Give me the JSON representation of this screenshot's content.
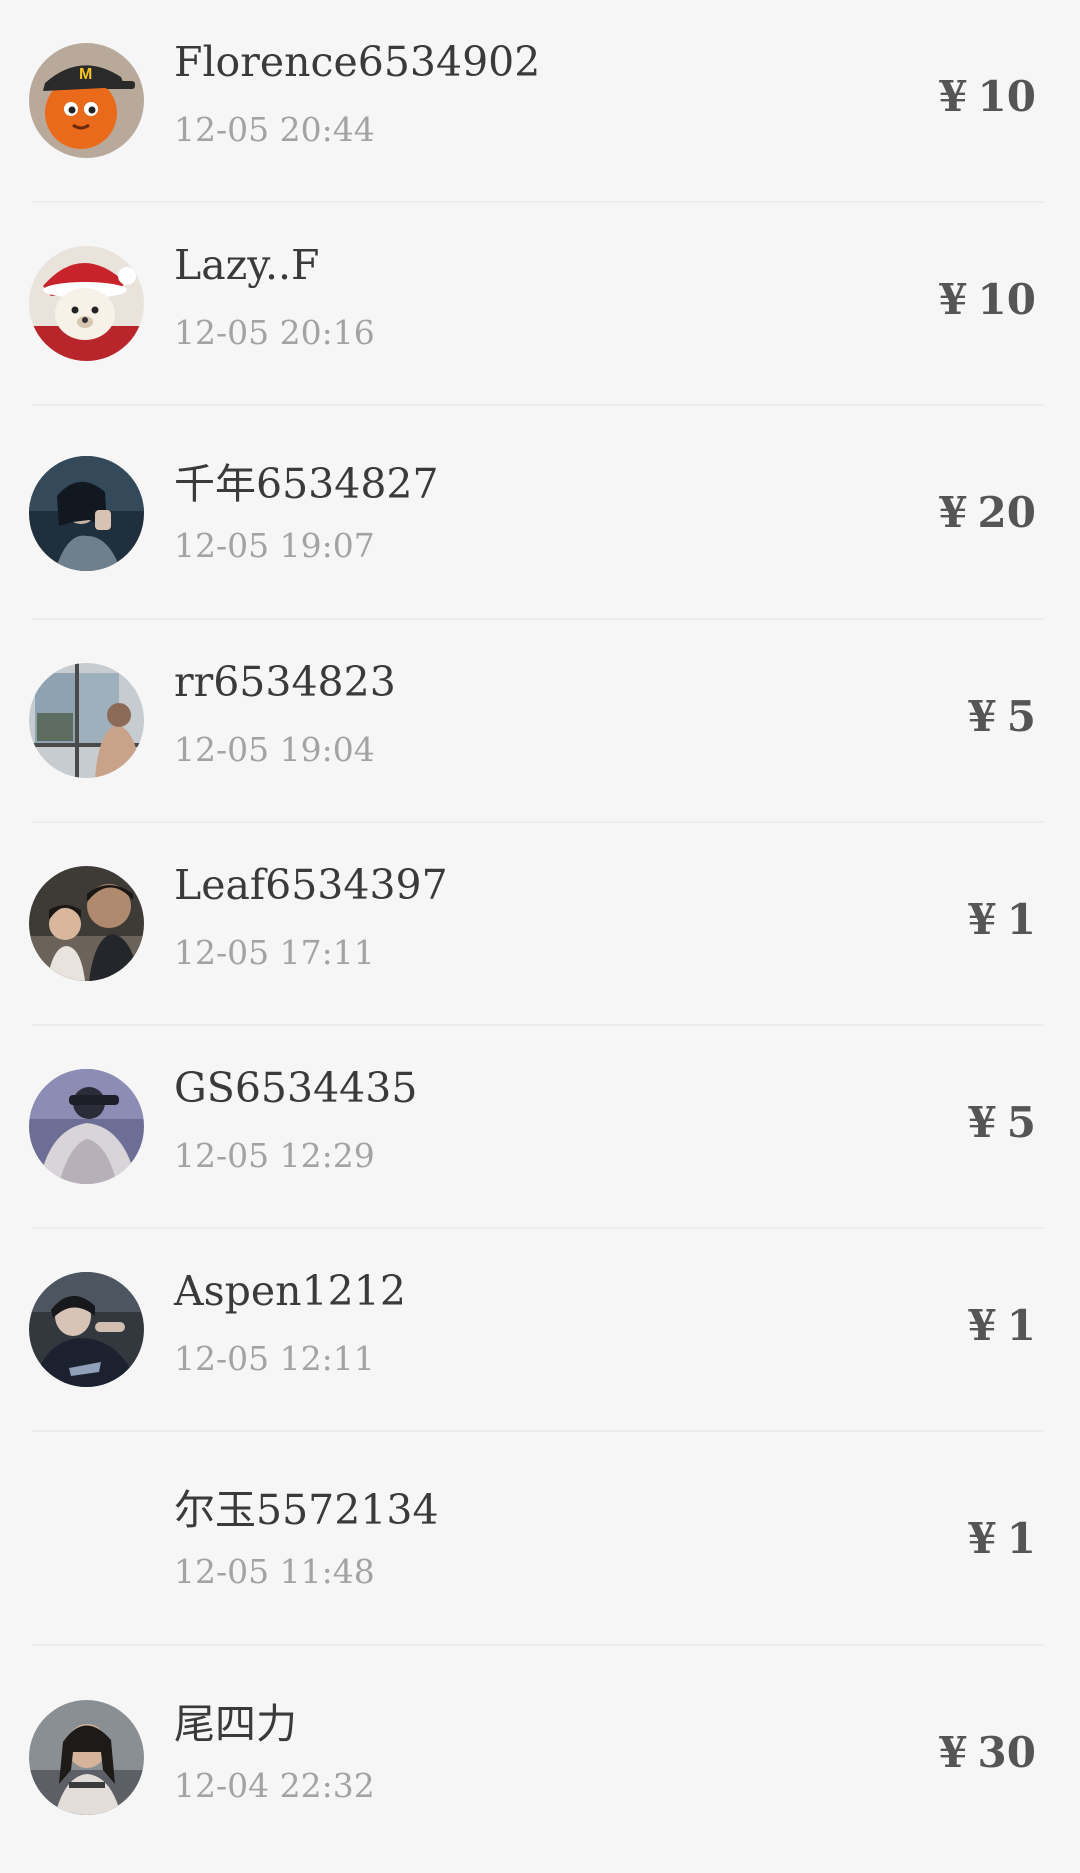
{
  "currency_symbol": "¥",
  "items": [
    {
      "name": "Florence6534902",
      "time": "12-05 20:44",
      "amount": "10",
      "avatar_icon": "mascot-avatar"
    },
    {
      "name": "Lazy..F",
      "time": "12-05 20:16",
      "amount": "10",
      "avatar_icon": "bear-avatar"
    },
    {
      "name": "千年6534827",
      "time": "12-05 19:07",
      "amount": "20",
      "avatar_icon": "photo-avatar"
    },
    {
      "name": "rr6534823",
      "time": "12-05 19:04",
      "amount": "5",
      "avatar_icon": "window-avatar"
    },
    {
      "name": "Leaf6534397",
      "time": "12-05 17:11",
      "amount": "1",
      "avatar_icon": "photo-avatar"
    },
    {
      "name": "GS6534435",
      "time": "12-05 12:29",
      "amount": "5",
      "avatar_icon": "photo-avatar"
    },
    {
      "name": "Aspen1212",
      "time": "12-05 12:11",
      "amount": "1",
      "avatar_icon": "photo-avatar"
    },
    {
      "name": "尔玉5572134",
      "time": "12-05 11:48",
      "amount": "1",
      "avatar_icon": ""
    },
    {
      "name": "尾四力",
      "time": "12-04 22:32",
      "amount": "30",
      "avatar_icon": "photo-avatar"
    }
  ]
}
